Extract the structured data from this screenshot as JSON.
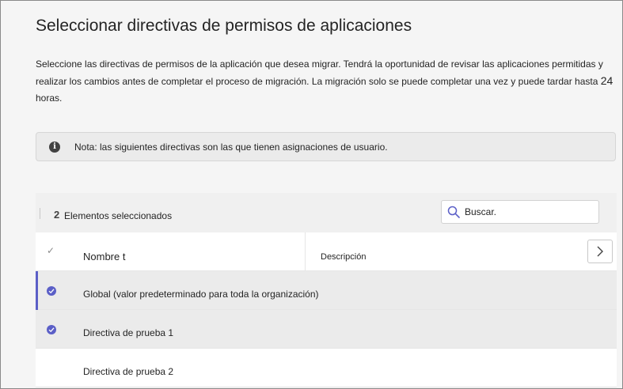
{
  "dialog": {
    "title": "Seleccionar directivas de permisos de aplicaciones",
    "description_part1": "Seleccione las directivas de permisos de la aplicación que desea migrar. Tendrá la oportunidad de revisar las aplicaciones permitidas y realizar los cambios antes de completar el proceso de migración. La migración solo se puede completar una vez y puede tardar hasta",
    "description_hours_number": "24",
    "description_hours_word": "horas."
  },
  "note": {
    "icon": "info-icon",
    "text": "Nota: las siguientes directivas son las que tienen asignaciones de usuario."
  },
  "toolbar": {
    "selected_count": "2",
    "selected_label": "Elementos seleccionados",
    "search_placeholder": "Buscar."
  },
  "table": {
    "columns": {
      "name": "Nombre t",
      "description": "Descripción"
    },
    "rows": [
      {
        "name": "Global (valor predeterminado para toda la organización)",
        "selected": true
      },
      {
        "name": "Directiva de prueba 1",
        "selected": true
      },
      {
        "name": "Directiva de prueba 2",
        "selected": false
      }
    ]
  },
  "colors": {
    "accent": "#5b5fc7",
    "selected_row_bg": "#ebebeb",
    "note_bg": "#ebebeb"
  }
}
